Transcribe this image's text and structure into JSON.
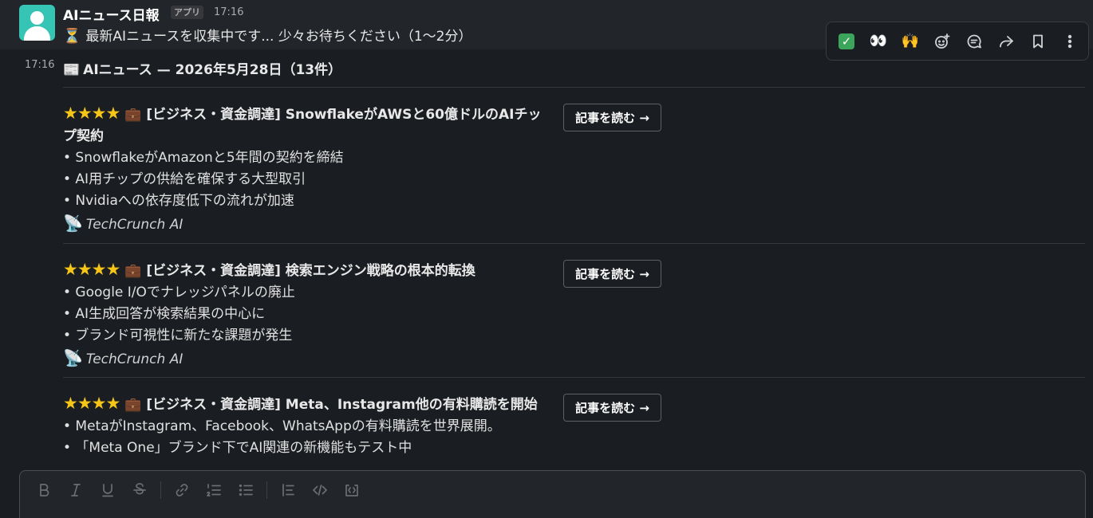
{
  "header_message": {
    "sender": "AIニュース日報",
    "badge": "アプリ",
    "time": "17:16",
    "status_emoji": "⏳",
    "status_text": "最新AIニュースを収集中です... 少々お待ちください（1〜2分）"
  },
  "actions": [
    "check-reaction",
    "eyes-reaction",
    "raised-hands-reaction",
    "add-reaction",
    "reply-in-thread",
    "share",
    "save",
    "more-actions"
  ],
  "actions_emoji": {
    "check": "✓",
    "eyes": "👀",
    "hands": "🙌"
  },
  "news_message": {
    "time": "17:16",
    "title_emoji": "📰",
    "title": "AIニュース — 2026年5月28日（13件）"
  },
  "articles": [
    {
      "stars": "★★★★",
      "category": "💼 [ビジネス・資金調達]",
      "title": "SnowflakeがAWSと60億ドルのAIチップ契約",
      "bullets": [
        "• SnowflakeがAmazonと5年間の契約を締結",
        "• AI用チップの供給を確保する大型取引",
        "• Nvidiaへの依存度低下の流れが加速"
      ],
      "source_icon": "📡",
      "source": "TechCrunch AI",
      "button": "記事を読む →"
    },
    {
      "stars": "★★★★",
      "category": "💼 [ビジネス・資金調達]",
      "title": "検索エンジン戦略の根本的転換",
      "bullets": [
        "• Google I/Oでナレッジパネルの廃止",
        "• AI生成回答が検索結果の中心に",
        "• ブランド可視性に新たな課題が発生"
      ],
      "source_icon": "📡",
      "source": "TechCrunch AI",
      "button": "記事を読む →"
    },
    {
      "stars": "★★★★",
      "category": "💼 [ビジネス・資金調達]",
      "title": "Meta、Instagram他の有料購読を開始",
      "bullets": [
        "• MetaがInstagram、Facebook、WhatsAppの有料購読を世界展開。",
        "• 「Meta One」ブランド下でAI関連の新機能もテスト中"
      ],
      "button": "記事を読む →"
    }
  ],
  "composer": {
    "tools": [
      "bold",
      "italic",
      "underline",
      "strikethrough",
      "link",
      "ordered-list",
      "bulleted-list",
      "blockquote",
      "code",
      "code-block"
    ]
  }
}
